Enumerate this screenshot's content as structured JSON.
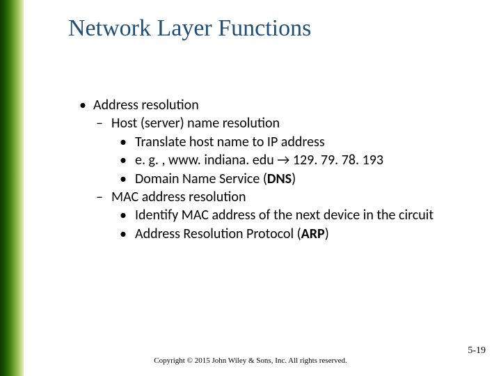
{
  "title": "Network Layer Functions",
  "b1": "Address resolution",
  "b1a": "Host (server) name resolution",
  "b1a1": "Translate host name to IP address",
  "b1a2": "e. g. , www. indiana. edu → 129. 79. 78. 193",
  "b1a3_pre": "Domain Name Service (",
  "b1a3_bold": "DNS",
  "b1a3_post": ")",
  "b1b": "MAC address resolution",
  "b1b1": "Identify MAC address of the next device in the circuit",
  "b1b2_pre": "Address Resolution Protocol (",
  "b1b2_bold": "ARP",
  "b1b2_post": ")",
  "copyright": "Copyright © 2015 John Wiley & Sons, Inc. All rights reserved.",
  "pagenum": "5-19"
}
